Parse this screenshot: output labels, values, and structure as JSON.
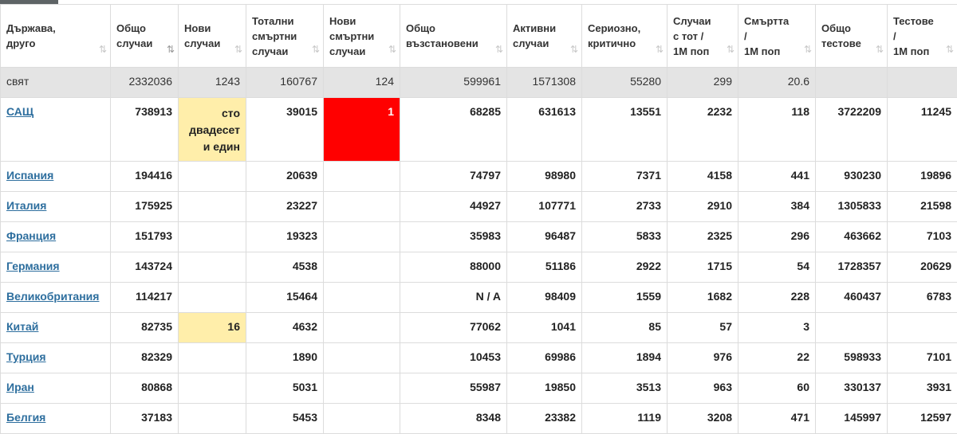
{
  "headers": [
    {
      "label": "Държава,\nдруго",
      "sort": "⇅",
      "active": false
    },
    {
      "label": "Общо\nслучаи",
      "sort": "⇅",
      "active": true
    },
    {
      "label": "Нови\nслучаи",
      "sort": "⇅",
      "active": false
    },
    {
      "label": "Тотални\nсмъртни\nслучаи",
      "sort": "⇅",
      "active": false
    },
    {
      "label": "Нови\nсмъртни\nслучаи",
      "sort": "⇅",
      "active": false
    },
    {
      "label": "Общо\nвъзстановени",
      "sort": "⇅",
      "active": false
    },
    {
      "label": "Активни\nслучаи",
      "sort": "⇅",
      "active": false
    },
    {
      "label": "Сериозно,\nкритично",
      "sort": "⇅",
      "active": false
    },
    {
      "label": "Случаи\nс тот /\n1M поп",
      "sort": "⇅",
      "active": false
    },
    {
      "label": "Смъртта\n/\n1M поп",
      "sort": "⇅",
      "active": false
    },
    {
      "label": "Общо\nтестове",
      "sort": "⇅",
      "active": false
    },
    {
      "label": "Тестове\n/\n1M поп",
      "sort": "⇅",
      "active": false
    }
  ],
  "world": [
    "свят",
    "2332036",
    "1243",
    "160767",
    "124",
    "599961",
    "1571308",
    "55280",
    "299",
    "20.6",
    "",
    ""
  ],
  "rows": [
    {
      "country": "САЩ",
      "values": [
        "738913",
        "сто\nдвадесет\nи един",
        "39015",
        "1",
        "68285",
        "631613",
        "13551",
        "2232",
        "118",
        "3722209",
        "11245"
      ]
    },
    {
      "country": "Испания",
      "values": [
        "194416",
        "",
        "20639",
        "",
        "74797",
        "98980",
        "7371",
        "4158",
        "441",
        "930230",
        "19896"
      ]
    },
    {
      "country": "Италия",
      "values": [
        "175925",
        "",
        "23227",
        "",
        "44927",
        "107771",
        "2733",
        "2910",
        "384",
        "1305833",
        "21598"
      ]
    },
    {
      "country": "Франция",
      "values": [
        "151793",
        "",
        "19323",
        "",
        "35983",
        "96487",
        "5833",
        "2325",
        "296",
        "463662",
        "7103"
      ]
    },
    {
      "country": "Германия",
      "values": [
        "143724",
        "",
        "4538",
        "",
        "88000",
        "51186",
        "2922",
        "1715",
        "54",
        "1728357",
        "20629"
      ]
    },
    {
      "country": "Великобритания",
      "values": [
        "114217",
        "",
        "15464",
        "",
        "N / A",
        "98409",
        "1559",
        "1682",
        "228",
        "460437",
        "6783"
      ]
    },
    {
      "country": "Китай",
      "values": [
        "82735",
        "16",
        "4632",
        "",
        "77062",
        "1041",
        "85",
        "57",
        "3",
        "",
        ""
      ]
    },
    {
      "country": "Турция",
      "values": [
        "82329",
        "",
        "1890",
        "",
        "10453",
        "69986",
        "1894",
        "976",
        "22",
        "598933",
        "7101"
      ]
    },
    {
      "country": "Иран",
      "values": [
        "80868",
        "",
        "5031",
        "",
        "55987",
        "19850",
        "3513",
        "963",
        "60",
        "330137",
        "3931"
      ]
    },
    {
      "country": "Белгия",
      "values": [
        "37183",
        "",
        "5453",
        "",
        "8348",
        "23382",
        "1119",
        "3208",
        "471",
        "145997",
        "12597"
      ]
    }
  ],
  "colors": {
    "new_cases_highlight": "#ffeeaa",
    "new_deaths_highlight": "#ff0000",
    "link": "#2d6e9e",
    "world_row": "#e4e4e4"
  }
}
